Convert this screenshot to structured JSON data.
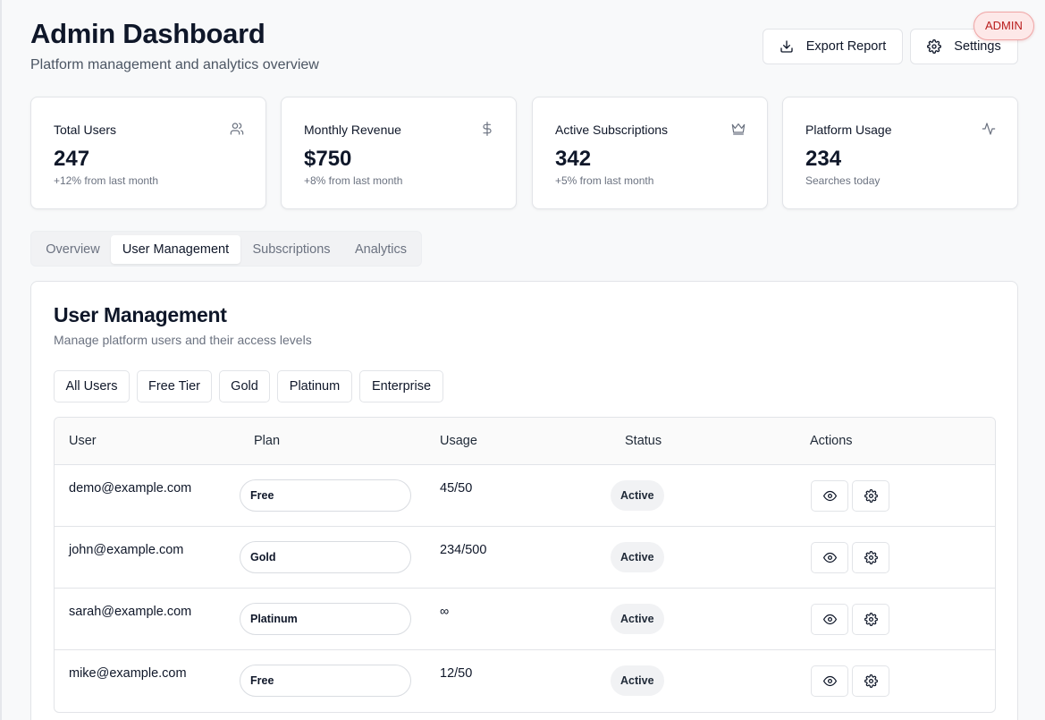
{
  "header": {
    "title": "Admin Dashboard",
    "subtitle": "Platform management and analytics overview",
    "badge": "ADMIN",
    "export_label": "Export Report",
    "settings_label": "Settings"
  },
  "stats": [
    {
      "label": "Total Users",
      "value": "247",
      "sub": "+12% from last month",
      "icon": "users-icon"
    },
    {
      "label": "Monthly Revenue",
      "value": "$750",
      "sub": "+8% from last month",
      "icon": "dollar-icon"
    },
    {
      "label": "Active Subscriptions",
      "value": "342",
      "sub": "+5% from last month",
      "icon": "crown-icon"
    },
    {
      "label": "Platform Usage",
      "value": "234",
      "sub": "Searches today",
      "icon": "activity-icon"
    }
  ],
  "tabs": [
    {
      "label": "Overview",
      "active": false
    },
    {
      "label": "User Management",
      "active": true
    },
    {
      "label": "Subscriptions",
      "active": false
    },
    {
      "label": "Analytics",
      "active": false
    }
  ],
  "panel": {
    "title": "User Management",
    "description": "Manage platform users and their access levels",
    "filters": [
      "All Users",
      "Free Tier",
      "Gold",
      "Platinum",
      "Enterprise"
    ]
  },
  "table": {
    "columns": [
      "User",
      "Plan",
      "Usage",
      "Status",
      "Actions"
    ],
    "rows": [
      {
        "user": "demo@example.com",
        "plan": "Free",
        "usage": "45/50",
        "status": "Active"
      },
      {
        "user": "john@example.com",
        "plan": "Gold",
        "usage": "234/500",
        "status": "Active"
      },
      {
        "user": "sarah@example.com",
        "plan": "Platinum",
        "usage": "∞",
        "status": "Active"
      },
      {
        "user": "mike@example.com",
        "plan": "Free",
        "usage": "12/50",
        "status": "Active"
      }
    ]
  },
  "colors": {
    "badge_bg": "#fde8e8",
    "badge_text": "#b91c1c",
    "text_primary": "#0f1729",
    "text_muted": "#6b7280"
  }
}
